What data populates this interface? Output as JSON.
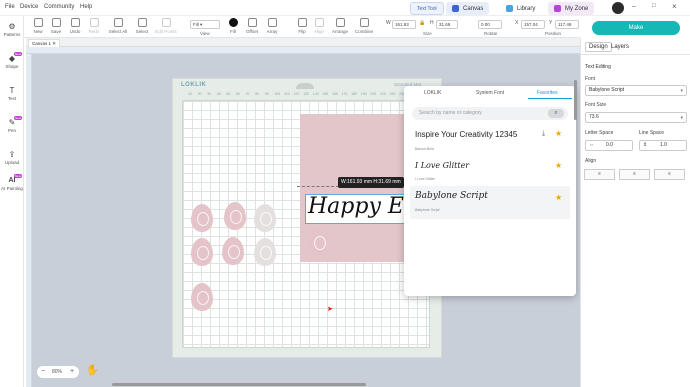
{
  "menu": [
    "File",
    "Device",
    "Community",
    "Help"
  ],
  "top_tabs": {
    "text_tool": "Text Tool",
    "canvas": "Canvas",
    "library": "Library",
    "my_zone": "My Zone"
  },
  "toolbar": {
    "new": "New",
    "save": "Save",
    "undo": "Undo",
    "redo": "Redo",
    "select_all": "Select All",
    "select": "Select",
    "edit_points": "Edit Points",
    "view": "View",
    "view_value": "Fill",
    "fill": "Fill",
    "offset": "Offset",
    "array": "Array",
    "flip": "Flip",
    "align": "Align",
    "arrange": "Arrange",
    "combine": "Combine",
    "size_label": "Size",
    "width": "161.93",
    "height": "31.69",
    "rotate_label": "Rotate",
    "rotate": "0.00",
    "position_label": "Position",
    "pos_x": "157.04",
    "pos_y": "117.49"
  },
  "make_button": "Make",
  "canvas_tab": "Canvas 1 ✕",
  "sidebar": [
    {
      "label": "Patterns",
      "icon": "pattern-icon",
      "glyph": "⚙",
      "badge": ""
    },
    {
      "label": "Shape",
      "icon": "shape-icon",
      "glyph": "◆",
      "badge": "New"
    },
    {
      "label": "Text",
      "icon": "text-icon",
      "glyph": "T",
      "badge": ""
    },
    {
      "label": "Pen",
      "icon": "pen-icon",
      "glyph": "✎",
      "badge": "New"
    },
    {
      "label": "Upload",
      "icon": "upload-icon",
      "glyph": "⇪",
      "badge": ""
    },
    {
      "label": "AI Painting",
      "icon": "ai-icon",
      "glyph": "AI",
      "badge": "New"
    }
  ],
  "mat": {
    "brand": "LOKLIK",
    "size_hint": "Standard Mat"
  },
  "ruler_marks": [
    "10",
    "20",
    "30",
    "40",
    "50",
    "60",
    "70",
    "80",
    "90",
    "100",
    "110",
    "120",
    "130",
    "140",
    "150",
    "160",
    "170",
    "180",
    "190",
    "200",
    "210",
    "220",
    "230",
    "240",
    "250"
  ],
  "selection": {
    "tooltip": "W:161.93 mm  H:31.69 mm",
    "text": "Happy Ea"
  },
  "zoom": {
    "value": "80%"
  },
  "font_panel": {
    "tabs": [
      "LOKLIK",
      "System Font",
      "Favorites"
    ],
    "search_placeholder": "Search by name or category",
    "favorites": [
      {
        "name": "Inspire Your Creativity 12345",
        "sub": "Barlow-Bold"
      },
      {
        "name": "I Love Glitter",
        "sub": "I Love Glitter"
      },
      {
        "name": "Babylone Script",
        "sub": "Babylone Script"
      }
    ]
  },
  "right_panel": {
    "tabs": [
      "Design",
      "Layers"
    ],
    "section": "Text Editing",
    "font_label": "Font",
    "font_value": "Babylone Script",
    "size_label": "Font Size",
    "size_value": "73.6",
    "letter_space_label": "Letter Space",
    "letter_space": "0.0",
    "line_space_label": "Line Space",
    "line_space": "1.0",
    "align_label": "Align"
  },
  "colors": {
    "accent": "#16b7b5",
    "link": "#1a9ad6",
    "star": "#f0a500",
    "tab_canvas": "#e8eef9",
    "tab_myzone": "#f3e8f7"
  }
}
